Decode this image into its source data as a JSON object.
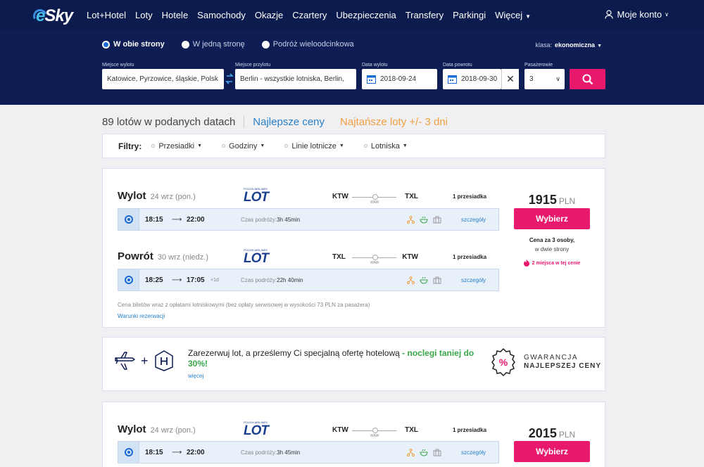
{
  "nav": {
    "logo_e": "e",
    "logo_rest": "Sky",
    "links": [
      "Lot+Hotel",
      "Loty",
      "Hotele",
      "Samochody",
      "Okazje",
      "Czartery",
      "Ubezpieczenia",
      "Transfery",
      "Parkingi",
      "Więcej"
    ],
    "account": "Moje konto"
  },
  "search": {
    "trip_types": [
      "W obie strony",
      "W jedną stronę",
      "Podróż wieloodcinkowa"
    ],
    "selected_trip_type": "W obie strony",
    "class_label": "klasa:",
    "class_value": "ekonomiczna",
    "labels": {
      "from": "Miejsce wylotu",
      "to": "Miejsce przylotu",
      "depart": "Data wylotu",
      "return": "Data powrotu",
      "passengers": "Pasażerowie"
    },
    "values": {
      "from": "Katowice, Pyrzowice, śląskie, Polsk",
      "to": "Berlin - wszystkie lotniska, Berlin,",
      "depart": "2018-09-24",
      "return": "2018-09-30",
      "passengers": "3"
    },
    "clear": "✕"
  },
  "results": {
    "count": "89 lotów w podanych datach",
    "best": "Najlepsze ceny",
    "cheap": "Najtańsze loty +/- 3 dni"
  },
  "filters": {
    "label": "Filtry:",
    "items": [
      "Przesiadki",
      "Godziny",
      "Linie lotnicze",
      "Lotniska"
    ]
  },
  "card1": {
    "out": {
      "title": "Wylot",
      "date": "24 wrz (pon.)",
      "airline_small": "POLISH AIRLINES",
      "airline": "LOT",
      "from": "KTW",
      "to": "TXL",
      "via": "WAW",
      "stops": "1 przesiadka",
      "dep": "18:15",
      "arr": "22:00",
      "plus_day": "",
      "dur_label": "Czas podróży:",
      "dur": "3h 45min",
      "details": "szczegóły"
    },
    "ret": {
      "title": "Powrót",
      "date": "30 wrz (niedz.)",
      "airline_small": "POLISH AIRLINES",
      "airline": "LOT",
      "from": "TXL",
      "to": "KTW",
      "via": "WAW",
      "stops": "1 przesiadka",
      "dep": "18:25",
      "arr": "17:05",
      "plus_day": "+1d",
      "dur_label": "Czas podróży:",
      "dur": "22h 40min",
      "details": "szczegóły"
    },
    "price": "1915",
    "currency": "PLN",
    "choose": "Wybierz",
    "note1": "Cena za 3 osoby,",
    "note2": "w dwie strony",
    "seats": "2 miejsca w tej cenie",
    "fine": "Cena biletów wraz z opłatami lotniskowymi (bez opłaty serwisowej w wysokości 73 PLN za pasażera)",
    "rules": "Warunki rezerwacji"
  },
  "promo": {
    "text_pre": "Zarezerwuj lot, a prześlemy Ci specjalną ofertę hotelową",
    "text_dash": " - ",
    "text_green": "noclegi taniej do 30%!",
    "more": "więcej",
    "guar1": "GWARANCJA",
    "guar2": "NAJLEPSZEJ CENY",
    "percent": "%"
  },
  "card2": {
    "out": {
      "title": "Wylot",
      "date": "24 wrz (pon.)",
      "airline_small": "POLISH AIRLINES",
      "airline": "LOT",
      "from": "KTW",
      "to": "TXL",
      "via": "WAW",
      "stops": "1 przesiadka",
      "dep": "18:15",
      "arr": "22:00",
      "dur_label": "Czas podróży:",
      "dur": "3h 45min",
      "details": "szczegóły"
    },
    "price": "2015",
    "currency": "PLN",
    "choose": "Wybierz"
  },
  "colors": {
    "nav_bg": "#0b1b4d",
    "accent_pink": "#e8186d",
    "link_blue": "#2a80c8",
    "orange": "#f0a040",
    "green": "#3aa64a"
  }
}
